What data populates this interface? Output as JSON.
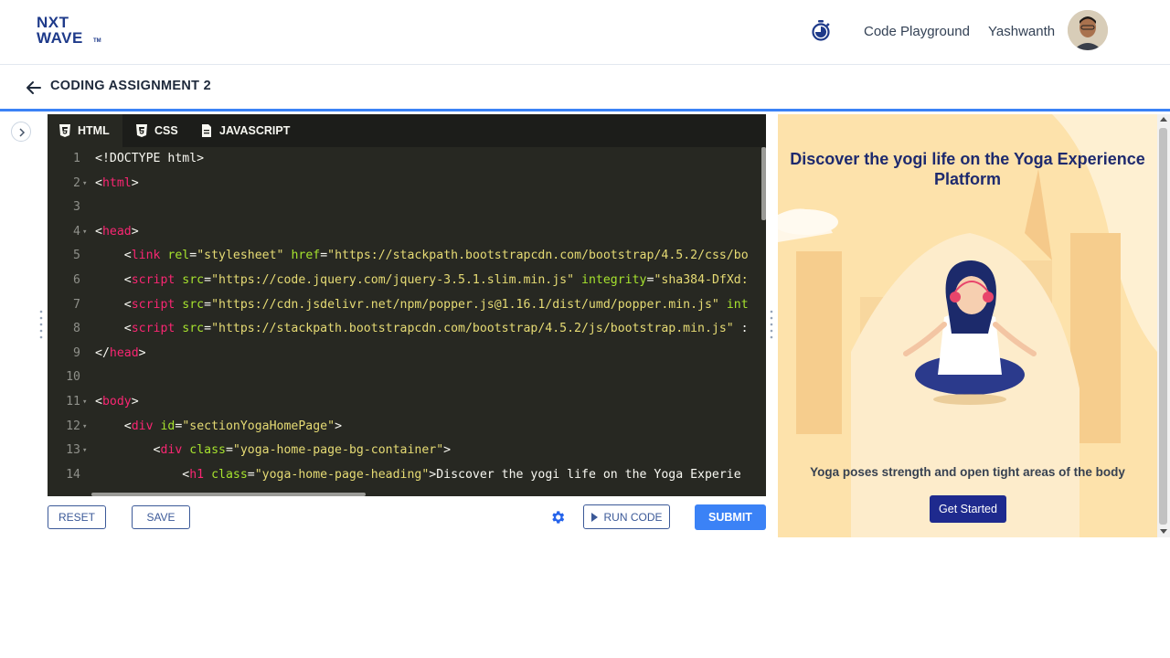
{
  "header": {
    "logo_line1": "NXT",
    "logo_line2": "WAVE",
    "logo_tm": "TM",
    "code_playground": "Code Playground",
    "user_name": "Yashwanth"
  },
  "subheader": {
    "title": "CODING ASSIGNMENT 2"
  },
  "editor": {
    "tabs": [
      {
        "label": "HTML",
        "icon": "html5-icon",
        "active": true
      },
      {
        "label": "CSS",
        "icon": "css3-icon",
        "active": false
      },
      {
        "label": "JAVASCRIPT",
        "icon": "file-icon",
        "active": false
      }
    ],
    "lines": [
      {
        "n": "1",
        "fold": "",
        "html": "&lt;!DOCTYPE html&gt;"
      },
      {
        "n": "2",
        "fold": "▾",
        "html": "&lt;<span class='tg'>html</span>&gt;"
      },
      {
        "n": "3",
        "fold": "",
        "html": ""
      },
      {
        "n": "4",
        "fold": "▾",
        "html": "&lt;<span class='tg'>head</span>&gt;"
      },
      {
        "n": "5",
        "fold": "",
        "html": "    &lt;<span class='tg'>link</span> <span class='at'>rel</span>=<span class='st'>\"stylesheet\"</span> <span class='at'>href</span>=<span class='st'>\"https://stackpath.bootstrapcdn.com/bootstrap/4.5.2/css/bo</span>"
      },
      {
        "n": "6",
        "fold": "",
        "html": "    &lt;<span class='tg'>script</span> <span class='at'>src</span>=<span class='st'>\"https://code.jquery.com/jquery-3.5.1.slim.min.js\"</span> <span class='at'>integrity</span>=<span class='st'>\"sha384-DfXd:</span>"
      },
      {
        "n": "7",
        "fold": "",
        "html": "    &lt;<span class='tg'>script</span> <span class='at'>src</span>=<span class='st'>\"https://cdn.jsdelivr.net/npm/popper.js@1.16.1/dist/umd/popper.min.js\"</span> <span class='at'>int</span>"
      },
      {
        "n": "8",
        "fold": "",
        "html": "    &lt;<span class='tg'>script</span> <span class='at'>src</span>=<span class='st'>\"https://stackpath.bootstrapcdn.com/bootstrap/4.5.2/js/bootstrap.min.js\"</span> :"
      },
      {
        "n": "9",
        "fold": "",
        "html": "&lt;/<span class='tg'>head</span>&gt;"
      },
      {
        "n": "10",
        "fold": "",
        "html": ""
      },
      {
        "n": "11",
        "fold": "▾",
        "html": "&lt;<span class='tg'>body</span>&gt;"
      },
      {
        "n": "12",
        "fold": "▾",
        "html": "    &lt;<span class='tg'>div</span> <span class='at'>id</span>=<span class='st'>\"sectionYogaHomePage\"</span>&gt;"
      },
      {
        "n": "13",
        "fold": "▾",
        "html": "        &lt;<span class='tg'>div</span> <span class='at'>class</span>=<span class='st'>\"yoga-home-page-bg-container\"</span>&gt;"
      },
      {
        "n": "14",
        "fold": "",
        "html": "            &lt;<span class='tg'>h1</span> <span class='at'>class</span>=<span class='st'>\"yoga-home-page-heading\"</span>&gt;Discover the yogi life on the Yoga Experie"
      }
    ]
  },
  "toolbar": {
    "reset": "RESET",
    "save": "SAVE",
    "run": "RUN CODE",
    "submit": "SUBMIT"
  },
  "preview": {
    "heading": "Discover the yogi life on the Yoga Experience Platform",
    "description": "Yoga poses strength and open tight areas of the body",
    "button": "Get Started",
    "bg_color": "#fde2ab",
    "accent": "#1e2a8e"
  }
}
